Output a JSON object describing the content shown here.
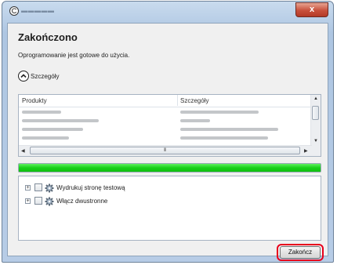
{
  "window": {
    "close_glyph": "x",
    "app_icon": "circle-c-icon",
    "title_obscured": true
  },
  "dialog": {
    "heading": "Zakończono",
    "message": "Oprogramowanie jest gotowe do użycia.",
    "details_label": "Szczegóły",
    "details_icon": "chevron-up-circle-icon"
  },
  "products_table": {
    "columns": [
      "Produkty",
      "Szczegóły"
    ],
    "rows_obscured": 4,
    "hscroll_grip": "III"
  },
  "progress": {
    "value": 1.0,
    "color": "#19d019"
  },
  "options": [
    {
      "label": "Wydrukuj stronę testową",
      "checked": false,
      "icon": "gear-icon",
      "expand": "+"
    },
    {
      "label": "Włącz dwustronne",
      "checked": false,
      "icon": "gear-icon",
      "expand": "+"
    }
  ],
  "footer": {
    "finish_label": "Zakończ",
    "highlight_color": "#e8001c"
  }
}
